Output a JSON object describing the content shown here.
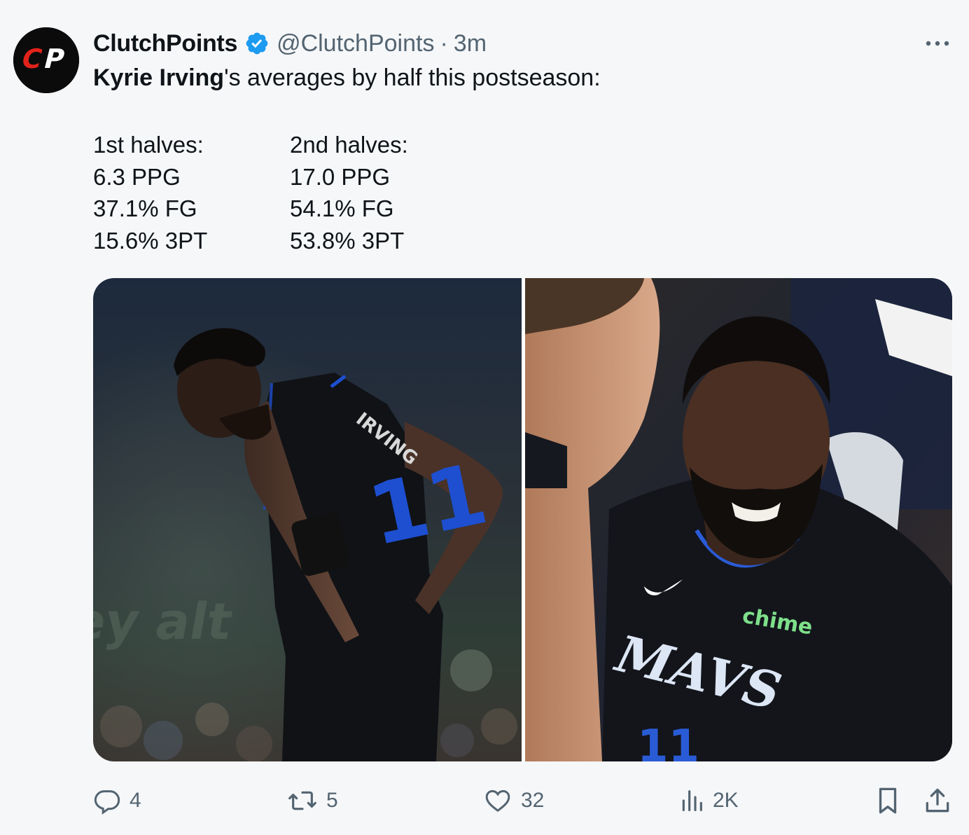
{
  "author": {
    "display_name": "ClutchPoints",
    "handle": "@ClutchPoints",
    "separator": "·",
    "time": "3m",
    "avatar_text": "CP",
    "verified": true
  },
  "tweet": {
    "intro_bold": "Kyrie Irving",
    "intro_rest": "'s averages by half this postseason:",
    "first_half": {
      "heading": "1st halves:",
      "lines": [
        "6.3 PPG",
        "37.1% FG",
        "15.6% 3PT"
      ]
    },
    "second_half": {
      "heading": "2nd halves:",
      "lines": [
        "17.0 PPG",
        "54.1% FG",
        "53.8% 3PT"
      ]
    }
  },
  "media": {
    "left_photo": {
      "jersey_name": "IRVING",
      "jersey_number": "11",
      "background_sign": "key alt"
    },
    "right_photo": {
      "sponsor": "chime",
      "team_wordmark": "MAVS",
      "jersey_number": "11"
    }
  },
  "actions": {
    "replies": "4",
    "reposts": "5",
    "likes": "32",
    "views": "2K"
  },
  "colors": {
    "background": "#f6f7f9",
    "text": "#0f1419",
    "muted": "#536471",
    "verified": "#1d9bf0",
    "brand_red": "#e2231a",
    "mavs_blue": "#0053bc"
  }
}
